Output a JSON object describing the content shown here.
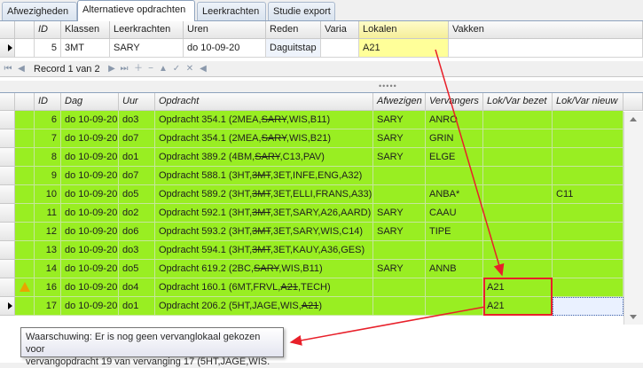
{
  "tabs": [
    {
      "label": "Afwezigheden"
    },
    {
      "label": "Alternatieve opdrachten"
    },
    {
      "label": "Leerkrachten"
    },
    {
      "label": "Studie export"
    }
  ],
  "top_grid": {
    "columns": [
      "ID",
      "Klassen",
      "Leerkrachten",
      "Uren",
      "Reden",
      "Varia",
      "Lokalen",
      "Vakken"
    ],
    "row": {
      "id": "5",
      "klassen": "3MT",
      "leerkrachten": "SARY",
      "uren": "do 10-09-20",
      "reden": "Daguitstap",
      "varia": "",
      "lokalen": "A21",
      "vakken": ""
    }
  },
  "navigator": {
    "record_text": "Record 1 van 2"
  },
  "bottom_grid": {
    "columns": [
      "ID",
      "Dag",
      "Uur",
      "Opdracht",
      "Afwezigen",
      "Vervangers",
      "Lok/Var bezet",
      "Lok/Var nieuw"
    ],
    "rows": [
      {
        "id": "6",
        "dag": "do 10-09-20",
        "uur": "do3",
        "opdracht_pre": "Opdracht 354.1 (2MEA,",
        "opdracht_strike": "SARY",
        "opdracht_post": ",WIS,B11)",
        "afwezigen": "SARY",
        "vervangers": "ANRO",
        "bezet": "",
        "nieuw": ""
      },
      {
        "id": "7",
        "dag": "do 10-09-20",
        "uur": "do7",
        "opdracht_pre": "Opdracht 354.1 (2MEA,",
        "opdracht_strike": "SARY",
        "opdracht_post": ",WIS,B21)",
        "afwezigen": "SARY",
        "vervangers": "GRIN",
        "bezet": "",
        "nieuw": ""
      },
      {
        "id": "8",
        "dag": "do 10-09-20",
        "uur": "do1",
        "opdracht_pre": "Opdracht 389.2 (4BM,",
        "opdracht_strike": "SARY",
        "opdracht_post": ",C13,PAV)",
        "afwezigen": "SARY",
        "vervangers": "ELGE",
        "bezet": "",
        "nieuw": ""
      },
      {
        "id": "9",
        "dag": "do 10-09-20",
        "uur": "do7",
        "opdracht_pre": "Opdracht 588.1 (3HT,",
        "opdracht_strike": "3MT",
        "opdracht_post": ",3ET,INFE,ENG,A32)",
        "afwezigen": "",
        "vervangers": "",
        "bezet": "",
        "nieuw": ""
      },
      {
        "id": "10",
        "dag": "do 10-09-20",
        "uur": "do5",
        "opdracht_pre": "Opdracht 589.2 (3HT,",
        "opdracht_strike": "3MT",
        "opdracht_post": ",3ET,ELLI,FRANS,A33)",
        "afwezigen": "",
        "vervangers": "ANBA*",
        "bezet": "",
        "nieuw": "C11"
      },
      {
        "id": "11",
        "dag": "do 10-09-20",
        "uur": "do2",
        "opdracht_pre": "Opdracht 592.1 (3HT,",
        "opdracht_strike": "3MT",
        "opdracht_post": ",3ET,SARY,A26,AARD)",
        "afwezigen": "SARY",
        "vervangers": "CAAU",
        "bezet": "",
        "nieuw": ""
      },
      {
        "id": "12",
        "dag": "do 10-09-20",
        "uur": "do6",
        "opdracht_pre": "Opdracht 593.2 (3HT,",
        "opdracht_strike": "3MT",
        "opdracht_post": ",3ET,SARY,WIS,C14)",
        "afwezigen": "SARY",
        "vervangers": "TIPE",
        "bezet": "",
        "nieuw": ""
      },
      {
        "id": "13",
        "dag": "do 10-09-20",
        "uur": "do3",
        "opdracht_pre": "Opdracht 594.1 (3HT,",
        "opdracht_strike": "3MT",
        "opdracht_post": ",3ET,KAUY,A36,GES)",
        "afwezigen": "",
        "vervangers": "",
        "bezet": "",
        "nieuw": ""
      },
      {
        "id": "14",
        "dag": "do 10-09-20",
        "uur": "do5",
        "opdracht_pre": "Opdracht 619.2 (2BC,",
        "opdracht_strike": "SARY",
        "opdracht_post": ",WIS,B11)",
        "afwezigen": "SARY",
        "vervangers": "ANNB",
        "bezet": "",
        "nieuw": ""
      },
      {
        "id": "16",
        "dag": "do 10-09-20",
        "uur": "do4",
        "opdracht_pre": "Opdracht 160.1 (6MT,FRVL,",
        "opdracht_strike": "A21",
        "opdracht_post": ",TECH)",
        "afwezigen": "",
        "vervangers": "",
        "bezet": "A21",
        "nieuw": ""
      },
      {
        "id": "17",
        "dag": "do 10-09-20",
        "uur": "do1",
        "opdracht_pre": "Opdracht 206.2 (5HT,JAGE,WIS,",
        "opdracht_strike": "A21",
        "opdracht_post": ")",
        "afwezigen": "",
        "vervangers": "",
        "bezet": "A21",
        "nieuw": ""
      }
    ]
  },
  "tooltip": {
    "line1": "Waarschuwing: Er is nog geen vervanglokaal gekozen voor",
    "line2": "vervangopdracht 19 van vervanging 17 (5HT,JAGE,WIS."
  },
  "colors": {
    "row_green": "#99ee22",
    "highlight_yellow": "#ffff99",
    "annotation_red": "#e8202a"
  }
}
